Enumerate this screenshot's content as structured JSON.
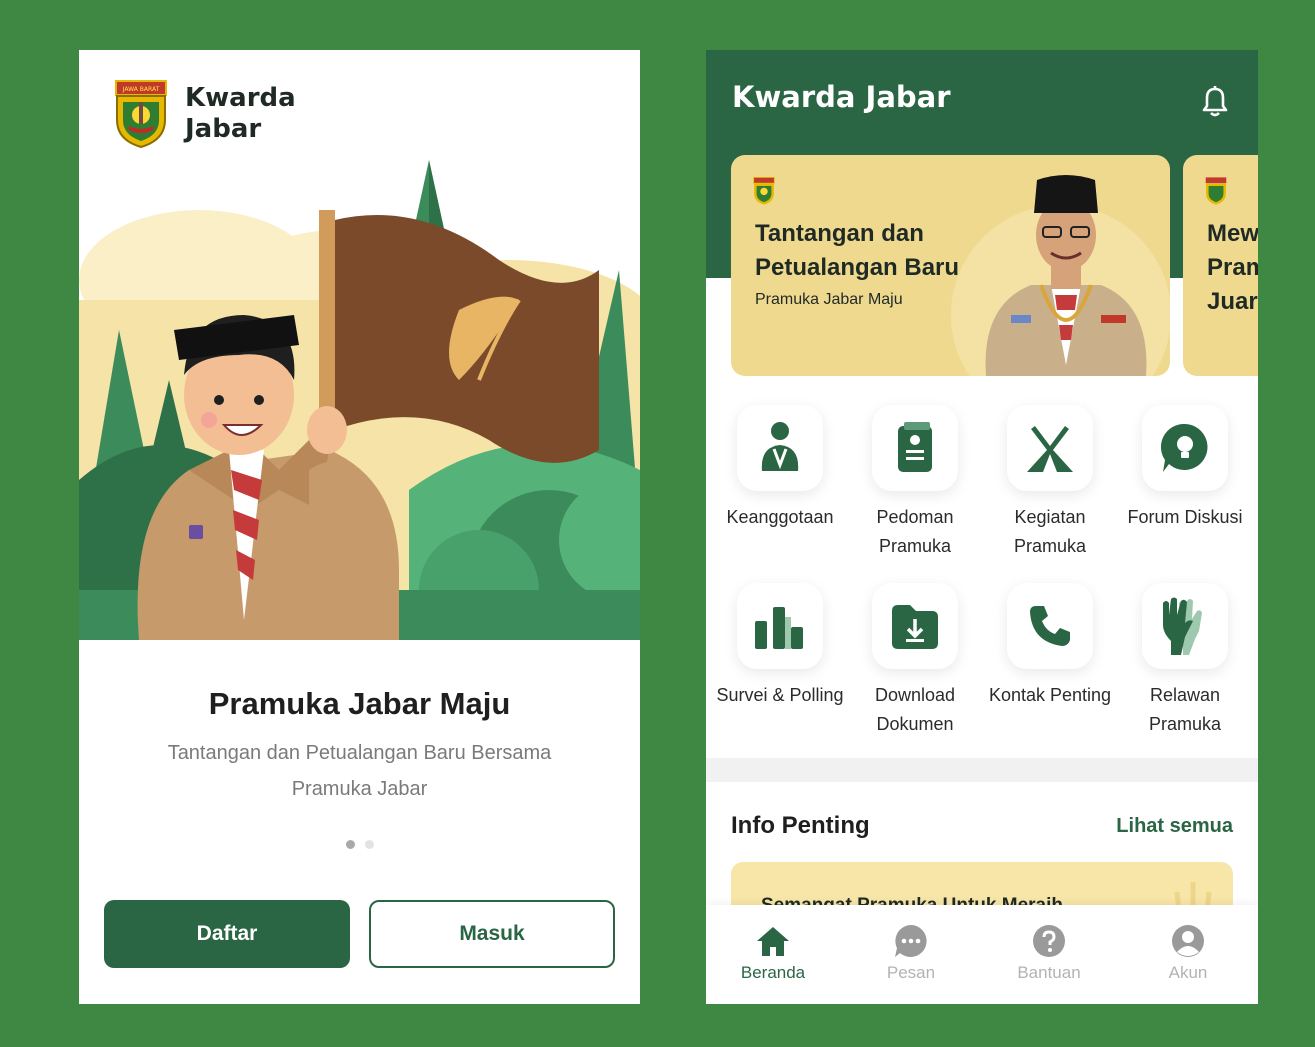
{
  "onboarding": {
    "brand_name": "Kwarda Jabar",
    "logo_text": "JAWA BARAT",
    "title": "Pramuka Jabar Maju",
    "subtitle": "Tantangan dan Petualangan Baru Bersama Pramuka Jabar",
    "page_count": 2,
    "active_page": 1,
    "register_label": "Daftar",
    "login_label": "Masuk"
  },
  "home": {
    "app_title": "Kwarda Jabar",
    "notification_icon": "bell-icon",
    "banners": [
      {
        "title": "Tantangan dan Petualangan Baru",
        "subtitle": "Pramuka Jabar Maju"
      },
      {
        "title": "Mew Pram Juara"
      }
    ],
    "menu": [
      {
        "label": "Keanggotaan",
        "icon": "member-icon"
      },
      {
        "label": "Pedoman Pramuka",
        "icon": "guide-book-icon"
      },
      {
        "label": "Kegiatan Pramuka",
        "icon": "tent-icon"
      },
      {
        "label": "Forum Diskusi",
        "icon": "discussion-bulb-icon"
      },
      {
        "label": "Survei & Polling",
        "icon": "bar-chart-icon"
      },
      {
        "label": "Download Dokumen",
        "icon": "download-folder-icon"
      },
      {
        "label": "Kontak Penting",
        "icon": "phone-icon"
      },
      {
        "label": "Relawan Pramuka",
        "icon": "hands-icon"
      }
    ],
    "info_section_title": "Info Penting",
    "info_see_all": "Lihat semua",
    "info_card_title": "Semangat Pramuka Untuk Meraih",
    "nav": [
      {
        "label": "Beranda",
        "icon": "home-icon",
        "active": true
      },
      {
        "label": "Pesan",
        "icon": "chat-icon",
        "active": false
      },
      {
        "label": "Bantuan",
        "icon": "help-icon",
        "active": false
      },
      {
        "label": "Akun",
        "icon": "account-icon",
        "active": false
      }
    ]
  },
  "colors": {
    "background": "#3F8844",
    "primary": "#2A6644",
    "banner": "#EFD98F",
    "card": "#F7E6A7"
  }
}
